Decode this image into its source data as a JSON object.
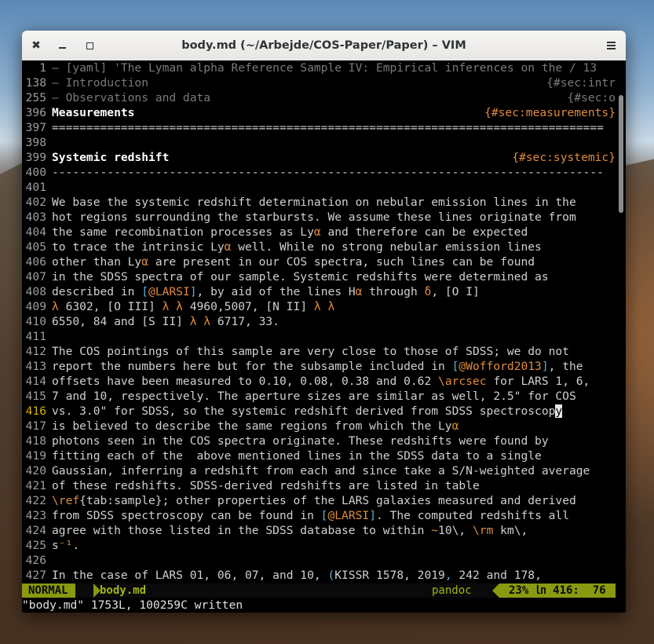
{
  "window": {
    "title": "body.md (~/Arbejde/COS-Paper/Paper) – VIM"
  },
  "buttons": {
    "close": "✖",
    "minimize": "minimize",
    "maximize": "maximize",
    "menu": "menu"
  },
  "lines": [
    {
      "num": "1",
      "text": "– [yaml] 'The Lyman alpha Reference Sample IV: Empirical inferences on the / 13"
    },
    {
      "num": "138",
      "text": "– Introduction",
      "tag": "{#sec:intr"
    },
    {
      "num": "255",
      "text": "– Observations and data",
      "tag": "{#sec:o"
    },
    {
      "num": "396",
      "text": "Measurements",
      "tag": "{#sec:measurements}"
    },
    {
      "num": "397",
      "text": "================================================================================"
    },
    {
      "num": "398",
      "text": ""
    },
    {
      "num": "399",
      "text": "Systemic redshift",
      "tag": "{#sec:systemic}"
    },
    {
      "num": "400",
      "text": "--------------------------------------------------------------------------------"
    },
    {
      "num": "401",
      "text": ""
    },
    {
      "num": "402",
      "text": "We base the systemic redshift determination on nebular emission lines in the"
    },
    {
      "num": "403",
      "text": "hot regions surrounding the starbursts. We assume these lines originate from"
    },
    {
      "num": "404",
      "pre": "the same recombination processes as Ly",
      "g": "α",
      "post": " and therefore can be expected"
    },
    {
      "num": "405",
      "pre": "to trace the intrinsic Ly",
      "g": "α",
      "post": " well. While no strong nebular emission lines"
    },
    {
      "num": "406",
      "pre": "other than Ly",
      "g": "α",
      "post": " are present in our COS spectra, such lines can be found"
    },
    {
      "num": "407",
      "text": "in the SDSS spectra of our sample. Systemic redshifts were determined as"
    },
    {
      "num": "408",
      "a": "described in ",
      "b": "[",
      "c": "@LARSI",
      "d": "]",
      "e": ", by aid of the lines H",
      "f": "α",
      "g2": " through ",
      "h": "δ",
      "i": ", [O I]"
    },
    {
      "num": "409",
      "g": "λ",
      "t1": " 6302, [O III] ",
      "g2": "λ λ",
      "t2": " 4960,5007, [N II] ",
      "g3": "λ λ"
    },
    {
      "num": "410",
      "t1": "6550, 84 and [S II] ",
      "g2": "λ λ",
      "t2": " 6717, 33."
    },
    {
      "num": "411",
      "text": ""
    },
    {
      "num": "412",
      "text": "The COS pointings of this sample are very close to those of SDSS; we do not"
    },
    {
      "num": "413",
      "a": "report the numbers here but for the subsample included in ",
      "b": "[",
      "c": "@Wofford2013",
      "d": "]",
      "e": ", the"
    },
    {
      "num": "414",
      "a": "offsets have been measured to 0.10, 0.08, 0.38 and 0.62 ",
      "l": "\\arcsec",
      "e": " for LARS 1, 6,"
    },
    {
      "num": "415",
      "text": "7 and 10, respectively. The aperture sizes are similar as well, 2.5\" for COS"
    },
    {
      "num": "416",
      "cur": true,
      "pre": "vs. 3.0\" for SDSS, so the systemic redshift derived from SDSS spectroscop",
      "cursor": "y"
    },
    {
      "num": "417",
      "pre": "is believed to describe the same regions from which the Ly",
      "g": "α"
    },
    {
      "num": "418",
      "text": "photons seen in the COS spectra originate. These redshifts were found by"
    },
    {
      "num": "419",
      "text": "fitting each of the  above mentioned lines in the SDSS data to a single"
    },
    {
      "num": "420",
      "text": "Gaussian, inferring a redshift from each and since take a S/N-weighted average"
    },
    {
      "num": "421",
      "text": "of these redshifts. SDSS-derived redshifts are listed in table"
    },
    {
      "num": "422",
      "l": "\\ref",
      "a": "{tab:sample}; other properties of the LARS galaxies measured and derived"
    },
    {
      "num": "423",
      "a": "from SDSS spectroscopy can be found in ",
      "b": "[",
      "c": "@LARSI",
      "d": "]",
      "e": ". The computed redshifts all"
    },
    {
      "num": "424",
      "a": "agree with those listed in the SDSS database to within ",
      "l": "∼",
      "e": "10\\, ",
      "l2": "\\rm",
      "f": " km\\,"
    },
    {
      "num": "425",
      "pre": "s",
      "g": "⁻¹",
      "post": "."
    },
    {
      "num": "426",
      "text": ""
    },
    {
      "num": "427",
      "a": "In the case of LARS 01, 06, 07, and 10, ",
      "b": "(",
      "e": "KISSR 1578, 2019",
      "d": ",",
      "f": " 242 and 178,"
    }
  ],
  "statusline": {
    "mode": "NORMAL",
    "filename": "body.md",
    "filetype": "pandoc",
    "position": "23% ㏑ 416:  76"
  },
  "cmdline": "\"body.md\" 1753L, 100259C written"
}
